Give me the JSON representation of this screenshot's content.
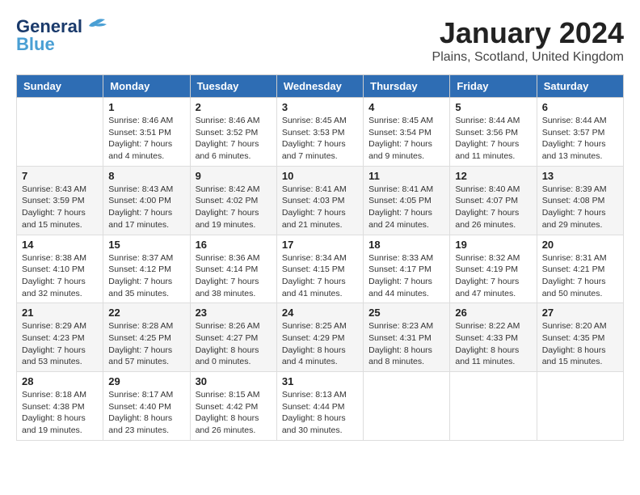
{
  "header": {
    "logo_line1": "General",
    "logo_line2": "Blue",
    "month_title": "January 2024",
    "subtitle": "Plains, Scotland, United Kingdom"
  },
  "days_of_week": [
    "Sunday",
    "Monday",
    "Tuesday",
    "Wednesday",
    "Thursday",
    "Friday",
    "Saturday"
  ],
  "weeks": [
    [
      {
        "day": "",
        "sunrise": "",
        "sunset": "",
        "daylight": ""
      },
      {
        "day": "1",
        "sunrise": "Sunrise: 8:46 AM",
        "sunset": "Sunset: 3:51 PM",
        "daylight": "Daylight: 7 hours and 4 minutes."
      },
      {
        "day": "2",
        "sunrise": "Sunrise: 8:46 AM",
        "sunset": "Sunset: 3:52 PM",
        "daylight": "Daylight: 7 hours and 6 minutes."
      },
      {
        "day": "3",
        "sunrise": "Sunrise: 8:45 AM",
        "sunset": "Sunset: 3:53 PM",
        "daylight": "Daylight: 7 hours and 7 minutes."
      },
      {
        "day": "4",
        "sunrise": "Sunrise: 8:45 AM",
        "sunset": "Sunset: 3:54 PM",
        "daylight": "Daylight: 7 hours and 9 minutes."
      },
      {
        "day": "5",
        "sunrise": "Sunrise: 8:44 AM",
        "sunset": "Sunset: 3:56 PM",
        "daylight": "Daylight: 7 hours and 11 minutes."
      },
      {
        "day": "6",
        "sunrise": "Sunrise: 8:44 AM",
        "sunset": "Sunset: 3:57 PM",
        "daylight": "Daylight: 7 hours and 13 minutes."
      }
    ],
    [
      {
        "day": "7",
        "sunrise": "Sunrise: 8:43 AM",
        "sunset": "Sunset: 3:59 PM",
        "daylight": "Daylight: 7 hours and 15 minutes."
      },
      {
        "day": "8",
        "sunrise": "Sunrise: 8:43 AM",
        "sunset": "Sunset: 4:00 PM",
        "daylight": "Daylight: 7 hours and 17 minutes."
      },
      {
        "day": "9",
        "sunrise": "Sunrise: 8:42 AM",
        "sunset": "Sunset: 4:02 PM",
        "daylight": "Daylight: 7 hours and 19 minutes."
      },
      {
        "day": "10",
        "sunrise": "Sunrise: 8:41 AM",
        "sunset": "Sunset: 4:03 PM",
        "daylight": "Daylight: 7 hours and 21 minutes."
      },
      {
        "day": "11",
        "sunrise": "Sunrise: 8:41 AM",
        "sunset": "Sunset: 4:05 PM",
        "daylight": "Daylight: 7 hours and 24 minutes."
      },
      {
        "day": "12",
        "sunrise": "Sunrise: 8:40 AM",
        "sunset": "Sunset: 4:07 PM",
        "daylight": "Daylight: 7 hours and 26 minutes."
      },
      {
        "day": "13",
        "sunrise": "Sunrise: 8:39 AM",
        "sunset": "Sunset: 4:08 PM",
        "daylight": "Daylight: 7 hours and 29 minutes."
      }
    ],
    [
      {
        "day": "14",
        "sunrise": "Sunrise: 8:38 AM",
        "sunset": "Sunset: 4:10 PM",
        "daylight": "Daylight: 7 hours and 32 minutes."
      },
      {
        "day": "15",
        "sunrise": "Sunrise: 8:37 AM",
        "sunset": "Sunset: 4:12 PM",
        "daylight": "Daylight: 7 hours and 35 minutes."
      },
      {
        "day": "16",
        "sunrise": "Sunrise: 8:36 AM",
        "sunset": "Sunset: 4:14 PM",
        "daylight": "Daylight: 7 hours and 38 minutes."
      },
      {
        "day": "17",
        "sunrise": "Sunrise: 8:34 AM",
        "sunset": "Sunset: 4:15 PM",
        "daylight": "Daylight: 7 hours and 41 minutes."
      },
      {
        "day": "18",
        "sunrise": "Sunrise: 8:33 AM",
        "sunset": "Sunset: 4:17 PM",
        "daylight": "Daylight: 7 hours and 44 minutes."
      },
      {
        "day": "19",
        "sunrise": "Sunrise: 8:32 AM",
        "sunset": "Sunset: 4:19 PM",
        "daylight": "Daylight: 7 hours and 47 minutes."
      },
      {
        "day": "20",
        "sunrise": "Sunrise: 8:31 AM",
        "sunset": "Sunset: 4:21 PM",
        "daylight": "Daylight: 7 hours and 50 minutes."
      }
    ],
    [
      {
        "day": "21",
        "sunrise": "Sunrise: 8:29 AM",
        "sunset": "Sunset: 4:23 PM",
        "daylight": "Daylight: 7 hours and 53 minutes."
      },
      {
        "day": "22",
        "sunrise": "Sunrise: 8:28 AM",
        "sunset": "Sunset: 4:25 PM",
        "daylight": "Daylight: 7 hours and 57 minutes."
      },
      {
        "day": "23",
        "sunrise": "Sunrise: 8:26 AM",
        "sunset": "Sunset: 4:27 PM",
        "daylight": "Daylight: 8 hours and 0 minutes."
      },
      {
        "day": "24",
        "sunrise": "Sunrise: 8:25 AM",
        "sunset": "Sunset: 4:29 PM",
        "daylight": "Daylight: 8 hours and 4 minutes."
      },
      {
        "day": "25",
        "sunrise": "Sunrise: 8:23 AM",
        "sunset": "Sunset: 4:31 PM",
        "daylight": "Daylight: 8 hours and 8 minutes."
      },
      {
        "day": "26",
        "sunrise": "Sunrise: 8:22 AM",
        "sunset": "Sunset: 4:33 PM",
        "daylight": "Daylight: 8 hours and 11 minutes."
      },
      {
        "day": "27",
        "sunrise": "Sunrise: 8:20 AM",
        "sunset": "Sunset: 4:35 PM",
        "daylight": "Daylight: 8 hours and 15 minutes."
      }
    ],
    [
      {
        "day": "28",
        "sunrise": "Sunrise: 8:18 AM",
        "sunset": "Sunset: 4:38 PM",
        "daylight": "Daylight: 8 hours and 19 minutes."
      },
      {
        "day": "29",
        "sunrise": "Sunrise: 8:17 AM",
        "sunset": "Sunset: 4:40 PM",
        "daylight": "Daylight: 8 hours and 23 minutes."
      },
      {
        "day": "30",
        "sunrise": "Sunrise: 8:15 AM",
        "sunset": "Sunset: 4:42 PM",
        "daylight": "Daylight: 8 hours and 26 minutes."
      },
      {
        "day": "31",
        "sunrise": "Sunrise: 8:13 AM",
        "sunset": "Sunset: 4:44 PM",
        "daylight": "Daylight: 8 hours and 30 minutes."
      },
      {
        "day": "",
        "sunrise": "",
        "sunset": "",
        "daylight": ""
      },
      {
        "day": "",
        "sunrise": "",
        "sunset": "",
        "daylight": ""
      },
      {
        "day": "",
        "sunrise": "",
        "sunset": "",
        "daylight": ""
      }
    ]
  ]
}
